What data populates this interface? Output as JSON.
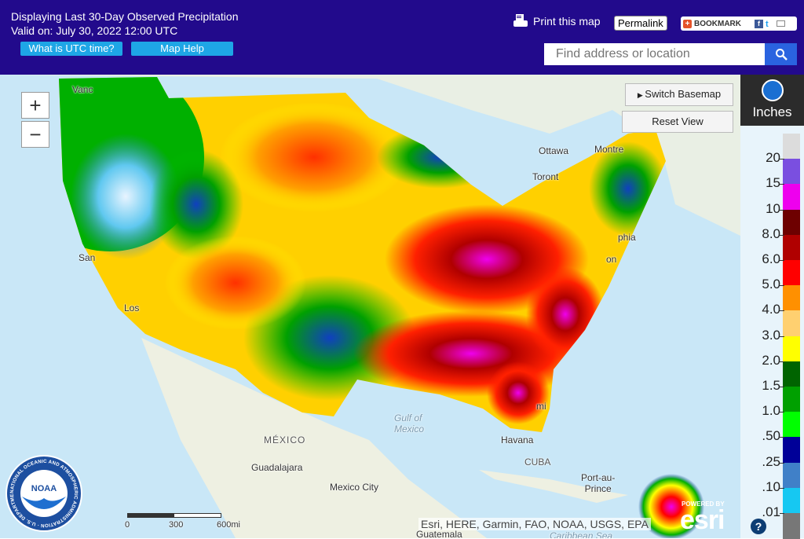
{
  "header": {
    "title_line1": "Displaying Last 30-Day Observed Precipitation",
    "title_line2": "Valid on: July 30, 2022 12:00 UTC",
    "utc_button": "What is UTC time?",
    "help_button": "Map Help",
    "print_label": "Print this map",
    "permalink_label": "Permalink",
    "bookmark_label": "BOOKMARK",
    "search_placeholder": "Find address or location",
    "icons": [
      "printer-icon",
      "search-icon",
      "facebook-icon",
      "twitter-icon",
      "email-icon"
    ]
  },
  "map": {
    "zoom_in": "+",
    "zoom_out": "−",
    "switch_basemap": "Switch Basemap",
    "reset_view": "Reset View",
    "labels": {
      "vancouver": "Vanc",
      "ottawa": "Ottawa",
      "montreal": "Montre",
      "toronto": "Toront",
      "philadelphia": "phia",
      "washington": "on",
      "san_francisco": "San",
      "los_angeles": "Los",
      "miami": "mi",
      "gulf": "Gulf of",
      "gulf2": "Mexico",
      "mexico": "MÉXICO",
      "guadalajara": "Guadalajara",
      "mexico_city": "Mexico City",
      "havana": "Havana",
      "cuba": "CUBA",
      "port_au_prince1": "Port-au-",
      "port_au_prince2": "Prince",
      "guatemala": "Guatemala",
      "caribbean": "Caribbean Sea"
    },
    "scale": {
      "zero": "0",
      "mid": "300",
      "end": "600mi"
    },
    "attribution": "Esri, HERE, Garmin, FAO, NOAA, USGS, EPA",
    "powered_by": "POWERED BY",
    "esri_logo": "esri",
    "noaa_seal_text": "NATIONAL OCEANIC AND ATMOSPHERIC ADMINISTRATION · U.S. DEPARTMENT OF COMMERCE",
    "noaa_logo_text": "NOAA"
  },
  "legend": {
    "unit": "Inches",
    "help": "?",
    "ticks": [
      "20",
      "15",
      "10",
      "8.0",
      "6.0",
      "5.0",
      "4.0",
      "3.0",
      "2.0",
      "1.5",
      "1.0",
      ".50",
      ".25",
      ".10",
      ".01"
    ],
    "colors": [
      "#dcdcdc",
      "#7a4fe0",
      "#ee00ee",
      "#6e0000",
      "#b00000",
      "#ff0000",
      "#ff9000",
      "#ffd070",
      "#ffff00",
      "#006400",
      "#00a000",
      "#00ff00",
      "#000098",
      "#4080c8",
      "#16c8f2",
      "#777777"
    ]
  }
}
